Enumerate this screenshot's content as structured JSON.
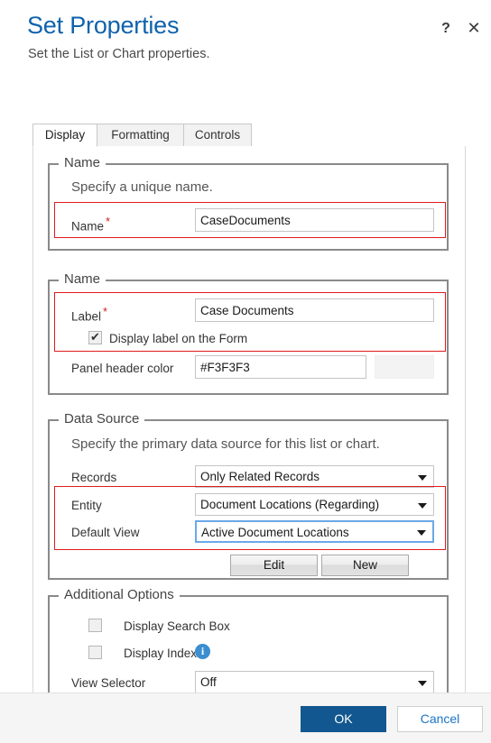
{
  "header": {
    "title": "Set Properties",
    "subtitle": "Set the List or Chart properties.",
    "help_icon": "?",
    "close_icon": "✕"
  },
  "tabs": [
    {
      "label": "Display",
      "active": true
    },
    {
      "label": "Formatting",
      "active": false
    },
    {
      "label": "Controls",
      "active": false
    }
  ],
  "sections": {
    "name_unique": {
      "legend": "Name",
      "helper": "Specify a unique name.",
      "name_label": "Name",
      "required_marker": "*",
      "name_value": "CaseDocuments"
    },
    "name_label": {
      "legend": "Name",
      "label_label": "Label",
      "required_marker": "*",
      "label_value": "Case Documents",
      "display_label_checkbox": {
        "label": "Display label on the Form",
        "checked": true
      },
      "panel_header_color_label": "Panel header color",
      "panel_header_color_value": "#F3F3F3",
      "panel_header_color_swatch": "#F3F3F3"
    },
    "data_source": {
      "legend": "Data Source",
      "helper": "Specify the primary data source for this list or chart.",
      "records_label": "Records",
      "records_value": "Only Related Records",
      "entity_label": "Entity",
      "entity_value": "Document Locations (Regarding)",
      "default_view_label": "Default View",
      "default_view_value": "Active Document Locations",
      "edit_button": "Edit",
      "new_button": "New"
    },
    "additional_options": {
      "legend": "Additional Options",
      "display_search_box": {
        "label": "Display Search Box",
        "checked": false
      },
      "display_index": {
        "label": "Display Index",
        "checked": false,
        "info_icon": "i"
      },
      "view_selector_label": "View Selector",
      "view_selector_value": "Off"
    }
  },
  "footer": {
    "ok_label": "OK",
    "cancel_label": "Cancel"
  },
  "colors": {
    "title_blue": "#1062ad",
    "primary_button": "#12578f",
    "link_blue": "#1b75c7",
    "highlight_red": "#e01b1b",
    "focus_blue": "#6aa9e8",
    "required_red": "#cc2222"
  }
}
